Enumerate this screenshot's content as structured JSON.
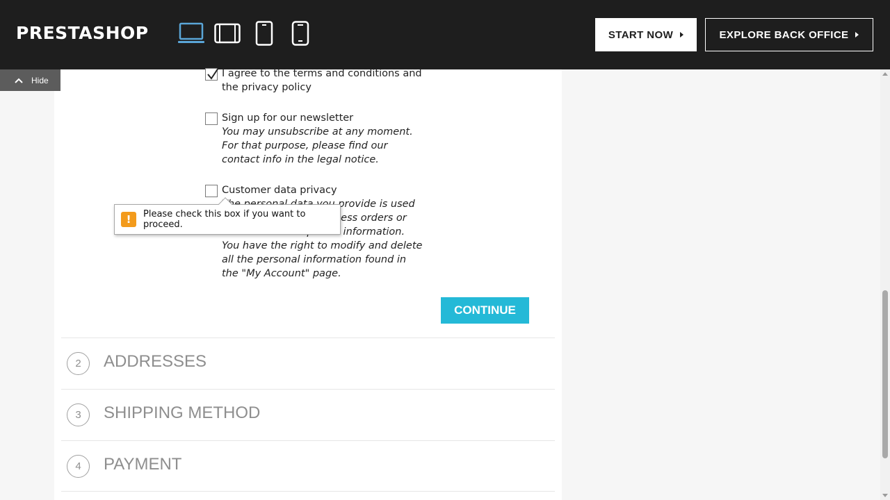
{
  "topbar": {
    "logo": "PRESTASHOP",
    "devices": [
      {
        "name": "desktop",
        "active": true
      },
      {
        "name": "tablet-landscape",
        "active": false
      },
      {
        "name": "tablet-portrait",
        "active": false
      },
      {
        "name": "mobile",
        "active": false
      }
    ],
    "start_now_label": "START NOW",
    "explore_label": "EXPLORE BACK OFFICE"
  },
  "hide_label": "Hide",
  "form": {
    "terms": {
      "checked": true,
      "label": "I agree to the terms and conditions and the privacy policy"
    },
    "newsletter": {
      "checked": false,
      "label": "Sign up for our newsletter",
      "note": "You may unsubscribe at any moment. For that purpose, please find our contact info in the legal notice."
    },
    "privacy": {
      "checked": false,
      "label": "Customer data privacy",
      "note": "The personal data you provide is used to answer queries, process orders or allow access to specific information. You have the right to modify and delete all the personal information found in the \"My Account\" page."
    },
    "continue_label": "CONTINUE"
  },
  "tooltip": {
    "message": "Please check this box if you want to proceed."
  },
  "steps": [
    {
      "number": "2",
      "title": "ADDRESSES"
    },
    {
      "number": "3",
      "title": "SHIPPING METHOD"
    },
    {
      "number": "4",
      "title": "PAYMENT"
    }
  ],
  "colors": {
    "accent": "#24b9d7",
    "topbar": "#1e1e1e",
    "warning": "#f39b1c",
    "device_active": "#5aa6d8"
  }
}
